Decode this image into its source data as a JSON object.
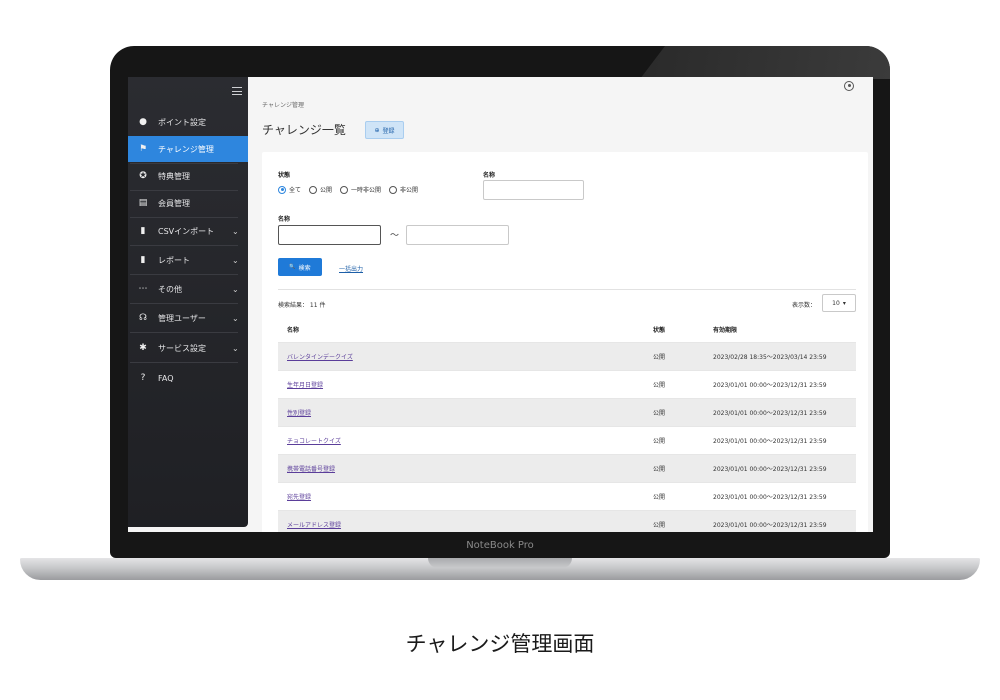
{
  "device": {
    "bezel_label": "NoteBook Pro"
  },
  "caption": "チャレンジ管理画面",
  "sidebar": {
    "items": [
      {
        "label": "ポイント設定",
        "icon": "piggy-bank-icon",
        "glyph": "●",
        "chevron": ""
      },
      {
        "label": "チャレンジ管理",
        "icon": "flag-icon",
        "glyph": "⚑",
        "chevron": "",
        "active": true
      },
      {
        "label": "特典管理",
        "icon": "award-icon",
        "glyph": "✪",
        "chevron": ""
      },
      {
        "label": "会員管理",
        "icon": "id-card-icon",
        "glyph": "▤",
        "chevron": ""
      },
      {
        "label": "CSVインポート",
        "icon": "file-import-icon",
        "glyph": "▮",
        "chevron": "⌄"
      },
      {
        "label": "レポート",
        "icon": "report-icon",
        "glyph": "▮",
        "chevron": "⌄"
      },
      {
        "label": "その他",
        "icon": "more-icon",
        "glyph": "⋯",
        "chevron": "⌄"
      },
      {
        "label": "管理ユーザー",
        "icon": "headset-icon",
        "glyph": "☊",
        "chevron": "⌄"
      },
      {
        "label": "サービス設定",
        "icon": "gear-icon",
        "glyph": "✱",
        "chevron": "⌄"
      },
      {
        "label": "FAQ",
        "icon": "question-icon",
        "glyph": "?",
        "chevron": ""
      }
    ]
  },
  "header": {
    "breadcrumb": "チャレンジ管理",
    "title": "チャレンジ一覧",
    "register_label": "登録",
    "register_glyph": "⊕"
  },
  "filters": {
    "status_label": "状態",
    "status_options": [
      "全て",
      "公開",
      "一時非公開",
      "非公開"
    ],
    "status_selected": "全て",
    "name_label_right": "名称",
    "name_label": "名称",
    "tilde": "〜",
    "search_label": "検索",
    "search_glyph": "🔍",
    "export_label": "一括出力"
  },
  "results": {
    "count_text": "検索結果： 11 件",
    "per_page_label": "表示数：",
    "per_page_value": "10",
    "per_page_caret": "▾",
    "columns": {
      "name": "名称",
      "status": "状態",
      "period": "有効期限"
    },
    "rows": [
      {
        "name": "バレンタインデークイズ",
        "status": "公開",
        "period": "2023/02/28 18:35～2023/03/14 23:59"
      },
      {
        "name": "生年月日登録",
        "status": "公開",
        "period": "2023/01/01 00:00～2023/12/31 23:59"
      },
      {
        "name": "性別登録",
        "status": "公開",
        "period": "2023/01/01 00:00～2023/12/31 23:59"
      },
      {
        "name": "チョコレートクイズ",
        "status": "公開",
        "period": "2023/01/01 00:00～2023/12/31 23:59"
      },
      {
        "name": "携帯電話番号登録",
        "status": "公開",
        "period": "2023/01/01 00:00～2023/12/31 23:59"
      },
      {
        "name": "宛先登録",
        "status": "公開",
        "period": "2023/01/01 00:00～2023/12/31 23:59"
      },
      {
        "name": "メールアドレス登録",
        "status": "公開",
        "period": "2023/01/01 00:00～2023/12/31 23:59"
      }
    ]
  },
  "colors": {
    "accent": "#2e86de",
    "sidebar": "#26272c",
    "link": "#5b3e9a"
  }
}
